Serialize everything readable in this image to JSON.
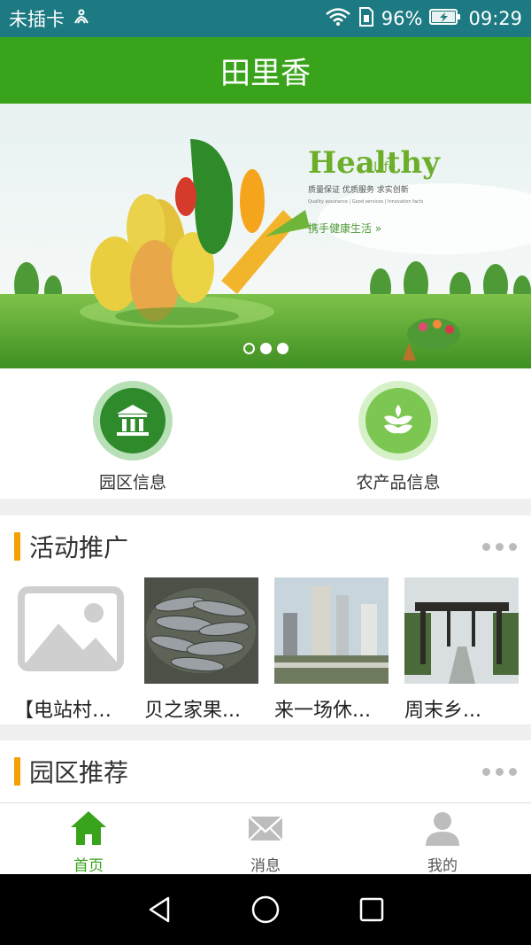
{
  "status": {
    "carrier": "未插卡",
    "battery": "96%",
    "time": "09:29"
  },
  "app": {
    "title": "田里香"
  },
  "banner": {
    "brand": "Healthy",
    "brand_small": "Life",
    "line1": "质量保证 优质服务 求实创新",
    "line2": "Quality assurance | Good services | Innovation facts",
    "slogan": "携手健康生活 »",
    "slide_count": 3,
    "active_slide": 2
  },
  "quick_links": [
    {
      "label": "园区信息",
      "icon": "building-icon"
    },
    {
      "label": "农产品信息",
      "icon": "wheat-icon"
    }
  ],
  "activities": {
    "title": "活动推广",
    "items": [
      {
        "caption": "【电站村】...",
        "image": "placeholder-image"
      },
      {
        "caption": "贝之家果...",
        "image": "fish-photo"
      },
      {
        "caption": "来一场休...",
        "image": "city-photo"
      },
      {
        "caption": "周末乡...",
        "image": "gate-photo"
      }
    ]
  },
  "parks": {
    "title": "园区推荐"
  },
  "tabs": [
    {
      "label": "首页",
      "icon": "home-icon",
      "active": true
    },
    {
      "label": "消息",
      "icon": "mail-icon",
      "active": false
    },
    {
      "label": "我的",
      "icon": "person-icon",
      "active": false
    }
  ],
  "colors": {
    "primary": "#3aa31c",
    "status_bar": "#1e7a82",
    "accent_bar": "#f5a000"
  }
}
